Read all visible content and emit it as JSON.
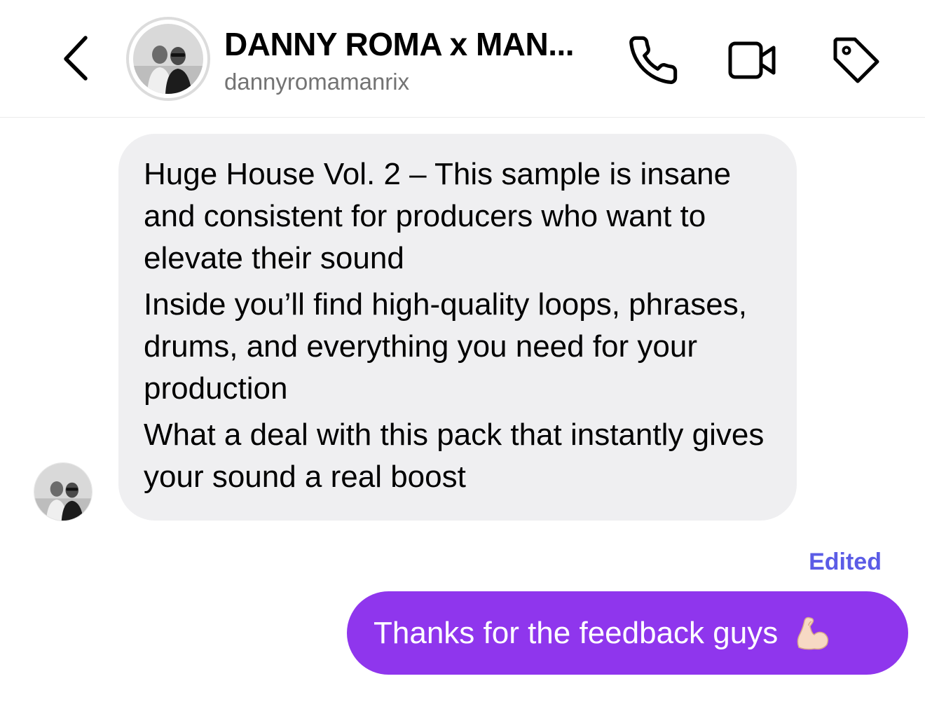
{
  "header": {
    "title": "DANNY ROMA x MAN...",
    "username": "dannyromamanrix",
    "icons": {
      "back": "chevron-left-icon",
      "call": "phone-icon",
      "video": "video-camera-icon",
      "tag": "tag-icon"
    }
  },
  "messages": {
    "incoming": {
      "paragraphs": [
        "Huge House Vol. 2 – This sample is insane and consistent for producers who want to elevate their sound",
        "Inside you’ll find high-quality loops, phrases, drums, and everything you need for your production",
        "What a deal with this pack that instantly gives your sound a real boost"
      ]
    },
    "outgoing": {
      "edited_label": "Edited",
      "text": "Thanks for the feedback guys",
      "emoji_icon": "flexed-biceps-icon"
    }
  },
  "colors": {
    "outgoing_bubble": "#8f36ed",
    "incoming_bubble": "#efeff1",
    "edited_label": "#5b5ce6",
    "secondary_text": "#737373"
  }
}
